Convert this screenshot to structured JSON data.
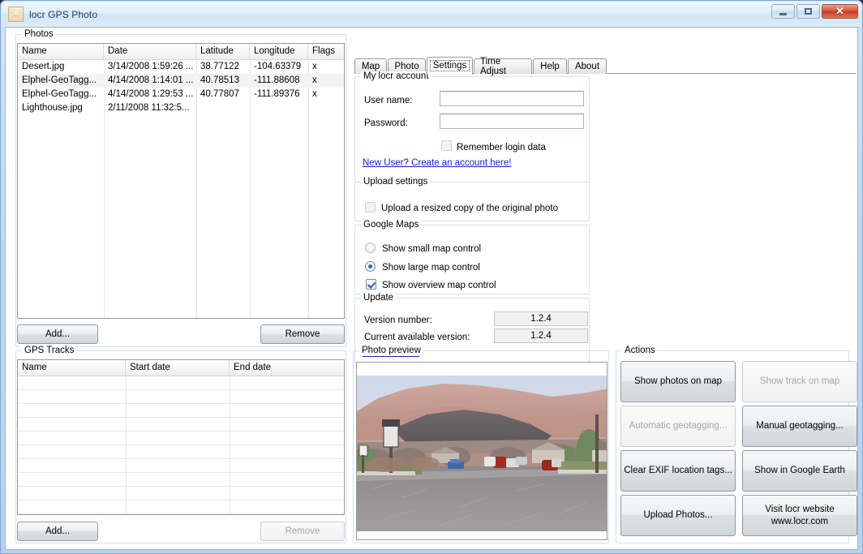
{
  "window": {
    "title": "locr GPS Photo",
    "icon": "app-icon",
    "buttons": {
      "minimize": "minimize-icon",
      "maximize": "maximize-icon",
      "close": "✕"
    }
  },
  "photos_panel": {
    "legend": "Photos",
    "columns": [
      "Name",
      "Date",
      "Latitude",
      "Longitude",
      "Flags"
    ],
    "rows": [
      {
        "name": "Desert.jpg",
        "date": "3/14/2008 1:59:26 ...",
        "latitude": "38.77122",
        "longitude": "-104.63379",
        "flags": "x"
      },
      {
        "name": "Elphel-GeoTagg...",
        "date": "4/14/2008 1:14:01 ...",
        "latitude": "40.78513",
        "longitude": "-111.88608",
        "flags": "x"
      },
      {
        "name": "Elphel-GeoTagg...",
        "date": "4/14/2008 1:29:53 ...",
        "latitude": "40.77807",
        "longitude": "-111.89376",
        "flags": "x"
      },
      {
        "name": "Lighthouse.jpg",
        "date": "2/11/2008 11:32:5...",
        "latitude": "",
        "longitude": "",
        "flags": ""
      }
    ],
    "add_label": "Add...",
    "remove_label": "Remove"
  },
  "tracks_panel": {
    "legend": "GPS Tracks",
    "columns": [
      "Name",
      "Start date",
      "End date"
    ],
    "rows": [],
    "add_label": "Add...",
    "remove_label": "Remove"
  },
  "tabs": [
    {
      "label": "Map",
      "active": false
    },
    {
      "label": "Photo",
      "active": false
    },
    {
      "label": "Settings",
      "active": true
    },
    {
      "label": "Time Adjust",
      "active": false
    },
    {
      "label": "Help",
      "active": false
    },
    {
      "label": "About",
      "active": false
    }
  ],
  "settings": {
    "account": {
      "legend": "My locr account",
      "username_label": "User name:",
      "username_value": "",
      "password_label": "Password:",
      "password_value": "",
      "remember_label": "Remember login data",
      "remember_checked": false,
      "signup_link": "New User? Create an account here!"
    },
    "upload": {
      "legend": "Upload settings",
      "resize_label": "Upload a resized copy of the original photo",
      "resize_checked": false
    },
    "google_maps": {
      "legend": "Google Maps",
      "small_label": "Show small map control",
      "large_label": "Show large map control",
      "selected": "large",
      "overview_label": "Show overview map control",
      "overview_checked": true
    },
    "update": {
      "legend": "Update",
      "version_label": "Version number:",
      "version_value": "1.2.4",
      "available_label": "Current available version:",
      "available_value": "1.2.4",
      "website_link": "www.locr.com"
    }
  },
  "preview_panel": {
    "legend": "Photo preview"
  },
  "actions_panel": {
    "legend": "Actions",
    "buttons": [
      {
        "label": "Show photos on map",
        "enabled": true
      },
      {
        "label": "Show track on map",
        "enabled": false
      },
      {
        "label": "Automatic geotagging...",
        "enabled": false
      },
      {
        "label": "Manual geotagging...",
        "enabled": true
      },
      {
        "label": "Clear EXIF location tags...",
        "enabled": true
      },
      {
        "label": "Show in Google Earth",
        "enabled": true
      },
      {
        "label": "Upload Photos...",
        "enabled": true
      },
      {
        "label": "Visit locr website\nwww.locr.com",
        "enabled": true
      }
    ]
  }
}
